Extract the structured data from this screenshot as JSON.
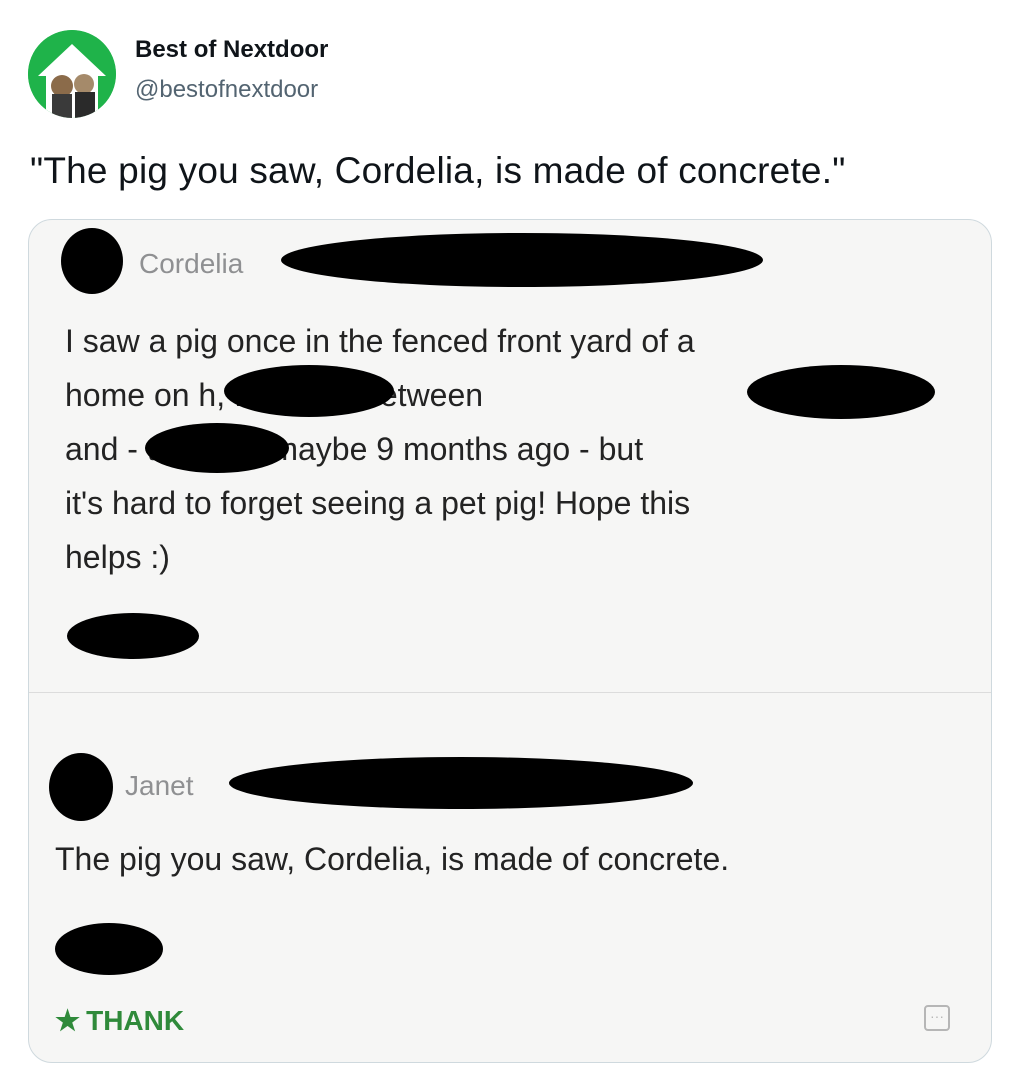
{
  "tweet": {
    "account_name": "Best of Nextdoor",
    "handle": "@bestofnextdoor",
    "text": "\"The pig you saw, Cordelia, is made of concrete.\""
  },
  "screenshot": {
    "comments": [
      {
        "name": "Cordelia",
        "text": "I saw a pig once in the fenced front yard of a\nhome on                 h, I believe between\nand              - this was maybe 9 months ago - but\nit's hard to forget seeing a pet pig! Hope this\nhelps :)"
      },
      {
        "name": "Janet",
        "text": "The pig you saw, Cordelia, is made of concrete."
      }
    ],
    "thank_label": "THANK",
    "more_label": "···"
  },
  "colors": {
    "avatar_bg": "#1fb34a",
    "thank_green": "#2f8a3a",
    "card_bg": "#f6f6f5"
  }
}
